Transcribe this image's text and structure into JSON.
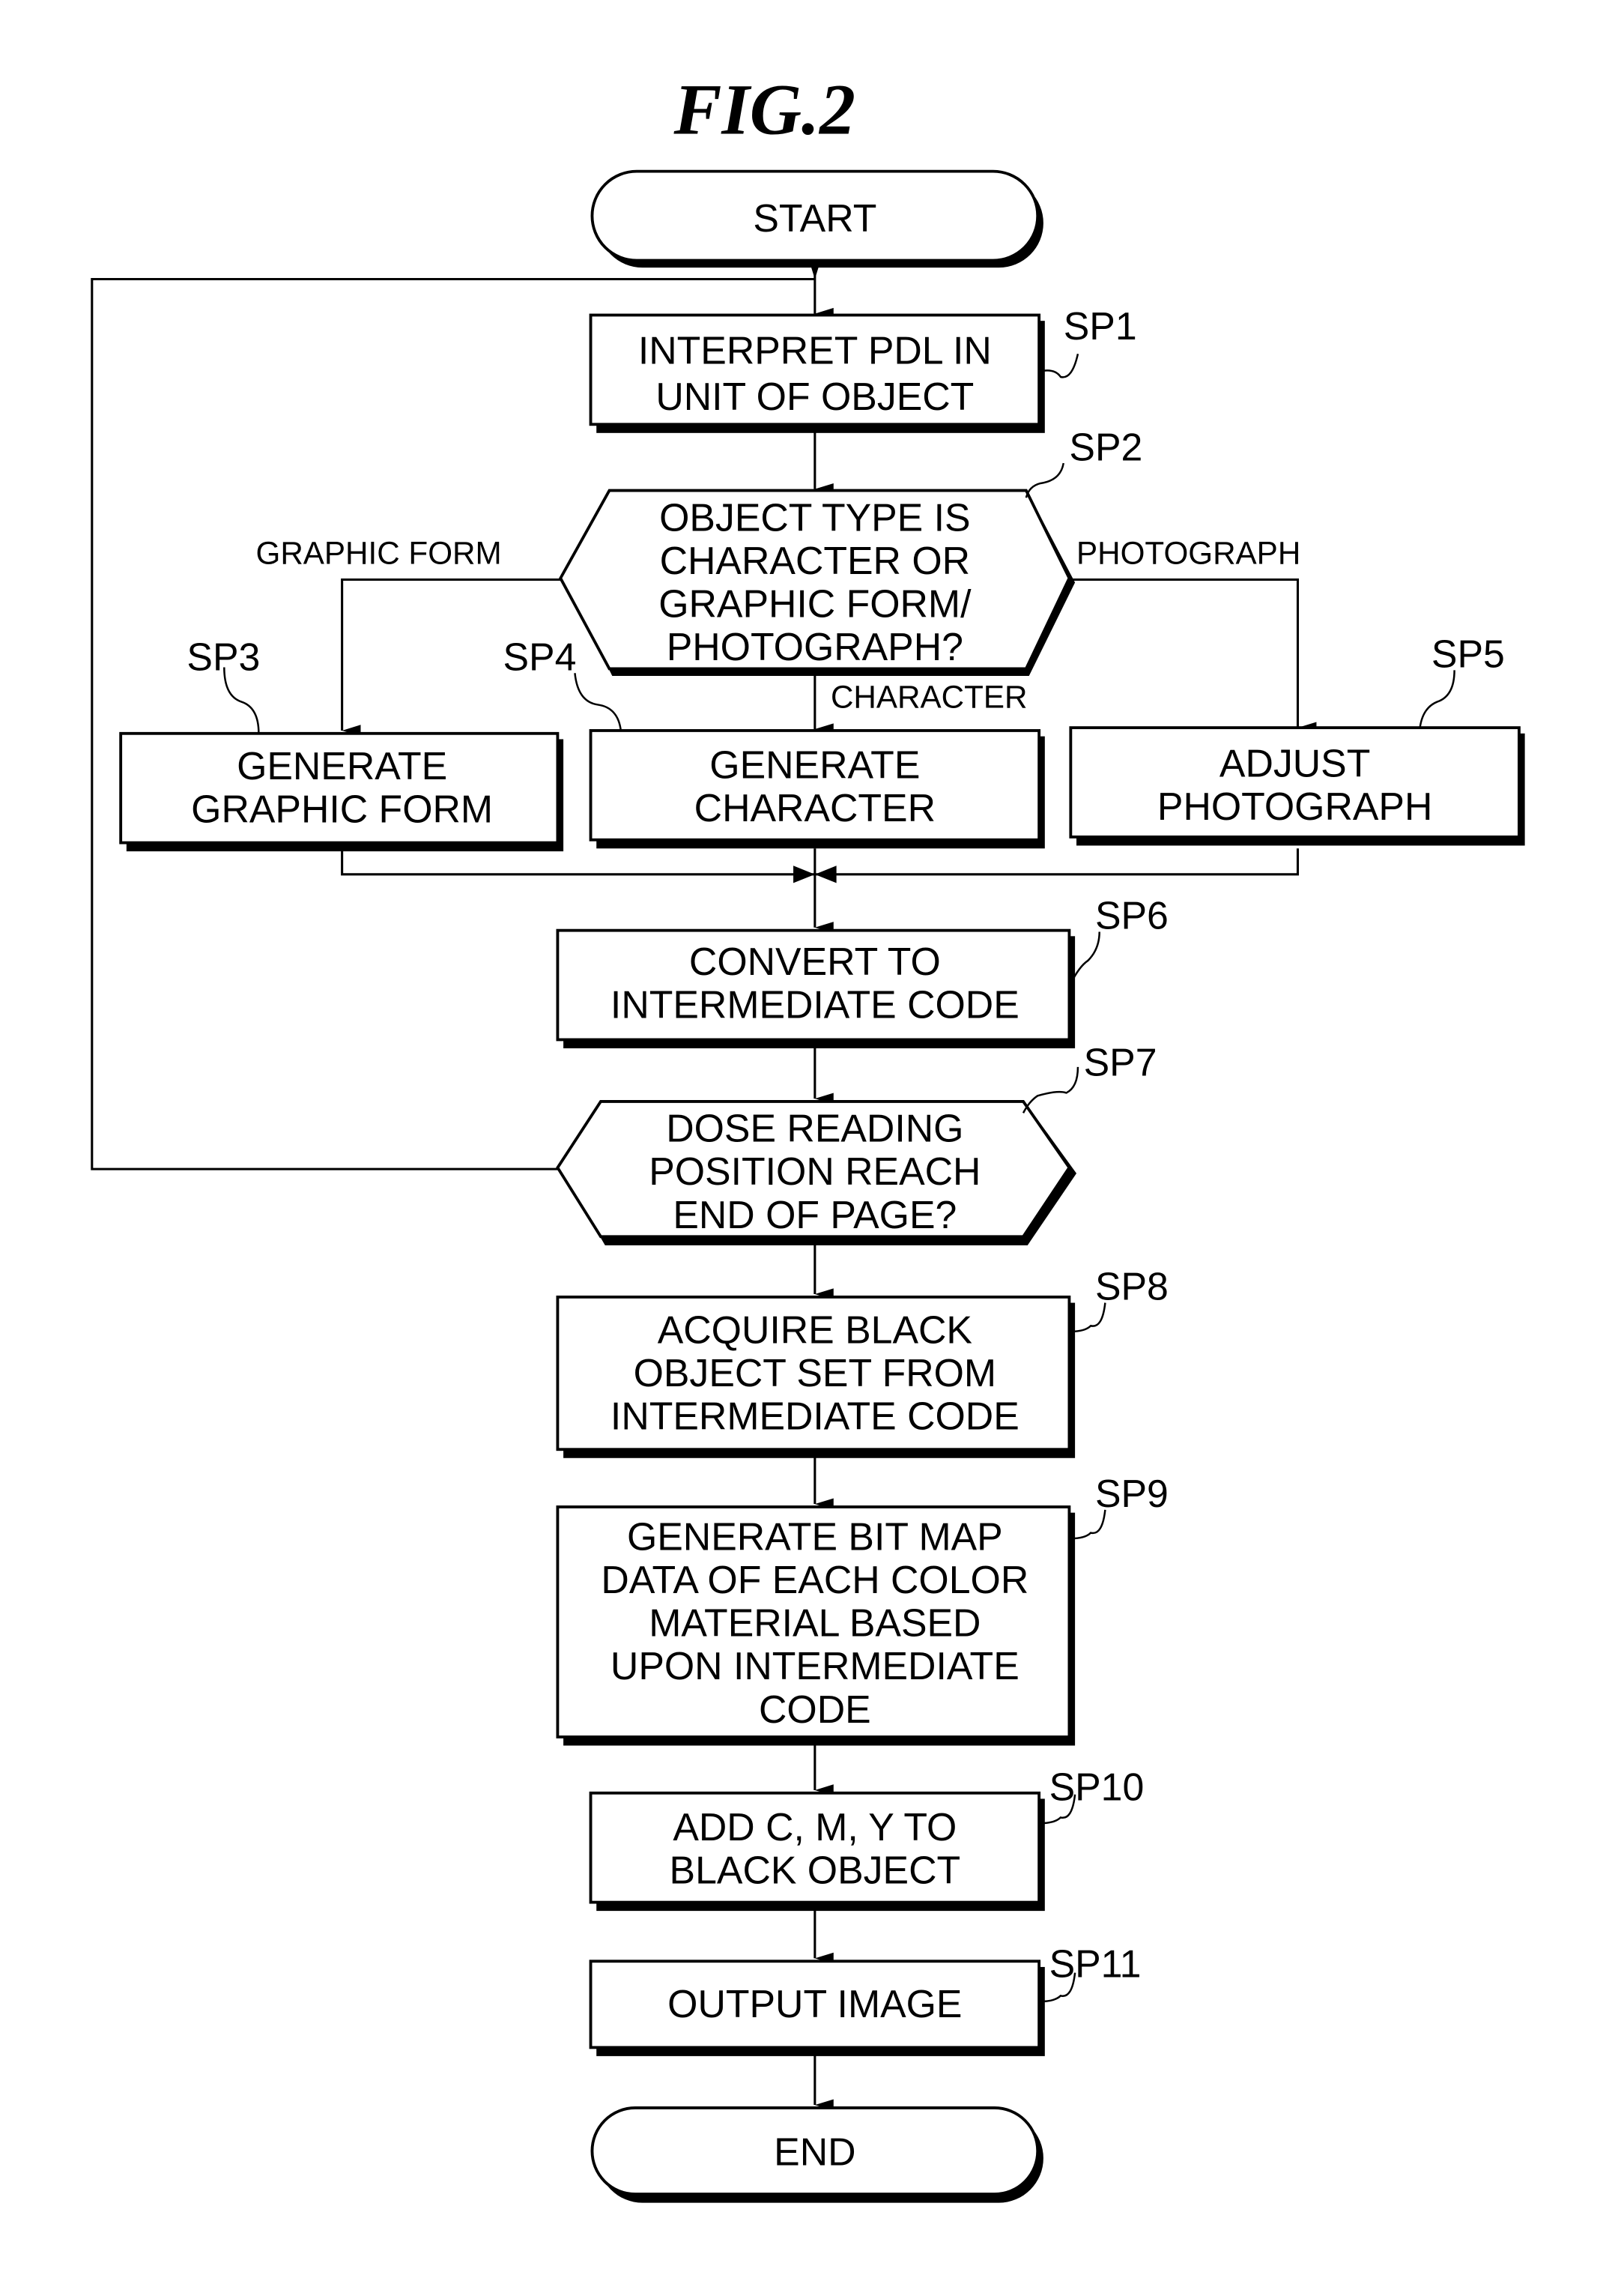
{
  "figure_title": "FIG.2",
  "nodes": {
    "start": {
      "lines": [
        "START"
      ]
    },
    "sp1": {
      "step": "SP1",
      "lines": [
        "INTERPRET PDL IN",
        "UNIT OF OBJECT"
      ]
    },
    "sp2": {
      "step": "SP2",
      "lines": [
        "OBJECT TYPE IS",
        "CHARACTER OR",
        "GRAPHIC FORM/",
        "PHOTOGRAPH?"
      ]
    },
    "sp3": {
      "step": "SP3",
      "lines": [
        "GENERATE",
        "GRAPHIC FORM"
      ]
    },
    "sp4": {
      "step": "SP4",
      "lines": [
        "GENERATE",
        "CHARACTER"
      ]
    },
    "sp5": {
      "step": "SP5",
      "lines": [
        "ADJUST",
        "PHOTOGRAPH"
      ]
    },
    "sp6": {
      "step": "SP6",
      "lines": [
        "CONVERT TO",
        "INTERMEDIATE CODE"
      ]
    },
    "sp7": {
      "step": "SP7",
      "lines": [
        "DOSE READING",
        "POSITION REACH",
        "END OF PAGE?"
      ]
    },
    "sp8": {
      "step": "SP8",
      "lines": [
        "ACQUIRE BLACK",
        "OBJECT SET FROM",
        "INTERMEDIATE CODE"
      ]
    },
    "sp9": {
      "step": "SP9",
      "lines": [
        "GENERATE BIT MAP",
        "DATA OF EACH COLOR",
        "MATERIAL BASED",
        "UPON INTERMEDIATE",
        "CODE"
      ]
    },
    "sp10": {
      "step": "SP10",
      "lines": [
        "ADD C, M, Y TO",
        "BLACK OBJECT"
      ]
    },
    "sp11": {
      "step": "SP11",
      "lines": [
        "OUTPUT IMAGE"
      ]
    },
    "end": {
      "lines": [
        "END"
      ]
    }
  },
  "branch_labels": {
    "graphic_form": "GRAPHIC FORM",
    "photograph": "PHOTOGRAPH",
    "character": "CHARACTER"
  }
}
